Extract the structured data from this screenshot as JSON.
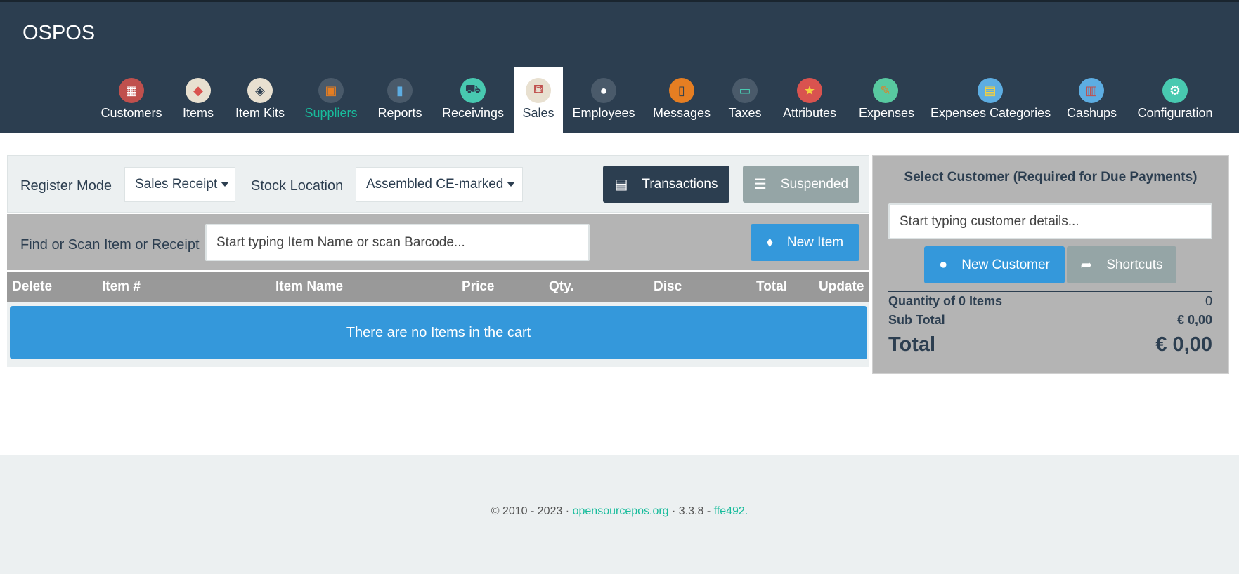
{
  "app": {
    "brand": "OSPOS"
  },
  "nav": {
    "items": [
      {
        "label": "Customers",
        "icon": "customers-icon",
        "color": "#d9534f",
        "glyph": "▦"
      },
      {
        "label": "Items",
        "icon": "tag-icon",
        "color": "#e8e0d0",
        "glyph": "🏷"
      },
      {
        "label": "Item Kits",
        "icon": "stack-icon",
        "color": "#e8e0d0",
        "glyph": "◈"
      },
      {
        "label": "Suppliers",
        "icon": "briefcase-icon",
        "color": "#4a5a6a",
        "glyph": "▣"
      },
      {
        "label": "Reports",
        "icon": "bar-chart-icon",
        "color": "#4a5a6a",
        "glyph": "▮"
      },
      {
        "label": "Receivings",
        "icon": "dolly-icon",
        "color": "#5bc0de",
        "glyph": "⛟"
      },
      {
        "label": "Sales",
        "icon": "basket-icon",
        "color": "#e8e0d0",
        "glyph": "⛾"
      },
      {
        "label": "Employees",
        "icon": "person-icon",
        "color": "#4a5a6a",
        "glyph": "●"
      },
      {
        "label": "Messages",
        "icon": "phone-icon",
        "color": "#e67e22",
        "glyph": "▯"
      },
      {
        "label": "Taxes",
        "icon": "money-icon",
        "color": "#4a5a6a",
        "glyph": "▭"
      },
      {
        "label": "Attributes",
        "icon": "star-icon",
        "color": "#d9534f",
        "glyph": "★"
      },
      {
        "label": "Expenses",
        "icon": "edit-icon",
        "color": "#5cb85c",
        "glyph": "✎"
      },
      {
        "label": "Expenses Categories",
        "icon": "clipboard-icon",
        "color": "#5dade2",
        "glyph": "▤"
      },
      {
        "label": "Cashups",
        "icon": "books-icon",
        "color": "#5dade2",
        "glyph": "▥"
      },
      {
        "label": "Configuration",
        "icon": "gear-icon",
        "color": "#48c9b0",
        "glyph": "⚙"
      }
    ],
    "active": "Sales",
    "highlighted": "Suppliers"
  },
  "register": {
    "mode_label": "Register Mode",
    "mode_value": "Sales Receipt",
    "stock_label": "Stock Location",
    "stock_value": "Assembled CE-marked",
    "transactions_label": "Transactions",
    "suspended_label": "Suspended"
  },
  "find": {
    "label": "Find or Scan Item or Receipt",
    "placeholder": "Start typing Item Name or scan Barcode...",
    "new_item_label": "New Item"
  },
  "cart": {
    "columns": [
      "Delete",
      "Item #",
      "Item Name",
      "Price",
      "Qty.",
      "Disc",
      "Total",
      "Update"
    ],
    "empty_message": "There are no Items in the cart"
  },
  "customer": {
    "title": "Select Customer (Required for Due Payments)",
    "placeholder": "Start typing customer details...",
    "new_customer_label": "New Customer",
    "shortcuts_label": "Shortcuts"
  },
  "summary": {
    "quantity_label": "Quantity of 0 Items",
    "quantity_value": "0",
    "subtotal_label": "Sub Total",
    "subtotal_value": "€ 0,00",
    "total_label": "Total",
    "total_value": "€ 0,00"
  },
  "footer": {
    "copyright": "© 2010 - 2023 ·",
    "link": "opensourcepos.org",
    "version": "· 3.3.8 -",
    "commit": "ffe492."
  },
  "colors": {
    "navbar": "#2c3e50",
    "accent": "#18bc9c",
    "primary": "#3498db",
    "dark_button": "#2c3e50",
    "muted_button": "#95a5a6"
  }
}
